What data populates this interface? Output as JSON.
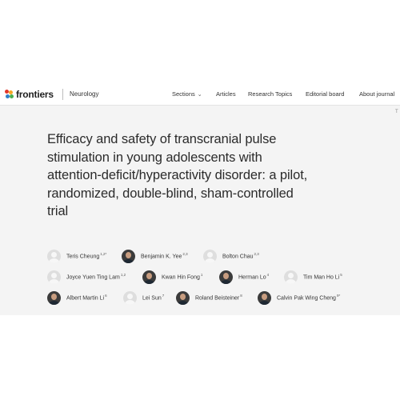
{
  "header": {
    "logo_text": "frontiers",
    "journal": "Neurology",
    "menu": [
      {
        "label": "Sections",
        "has_chevron": true
      },
      {
        "label": "Articles",
        "has_chevron": false
      },
      {
        "label": "Research Topics",
        "has_chevron": false
      },
      {
        "label": "Editorial board",
        "has_chevron": false
      },
      {
        "label": "About journal",
        "has_chevron": false
      }
    ],
    "edge_text": "T"
  },
  "article": {
    "title_lines": [
      "Efficacy and safety of transcranial pulse",
      "stimulation in young adolescents with",
      "attention-deficit/hyperactivity disorder: a pilot,",
      "randomized, double-blind, sham-controlled",
      "trial"
    ]
  },
  "authors": [
    {
      "name": "Teris Cheung",
      "aff": "1,2*",
      "photo": false
    },
    {
      "name": "Benjamin K. Yee",
      "aff": "2,3",
      "photo": true
    },
    {
      "name": "Bolton Chau",
      "aff": "2,3",
      "photo": false
    },
    {
      "name": "Joyce Yuen Ting Lam",
      "aff": "1,2",
      "photo": false
    },
    {
      "name": "Kwan Hin Fong",
      "aff": "1",
      "photo": true
    },
    {
      "name": "Herman Lo",
      "aff": "4",
      "photo": true
    },
    {
      "name": "Tim Man Ho Li",
      "aff": "5",
      "photo": false
    },
    {
      "name": "Albert Martin Li",
      "aff": "6",
      "photo": true
    },
    {
      "name": "Lei Sun",
      "aff": "7",
      "photo": false
    },
    {
      "name": "Roland Beisteiner",
      "aff": "8",
      "photo": true
    },
    {
      "name": "Calvin Pak Wing Cheng",
      "aff": "9*",
      "photo": true
    }
  ],
  "colors": {
    "logo_dots": [
      "#e2382c",
      "#f6a623",
      "#2f80c8",
      "#4caf50"
    ]
  }
}
